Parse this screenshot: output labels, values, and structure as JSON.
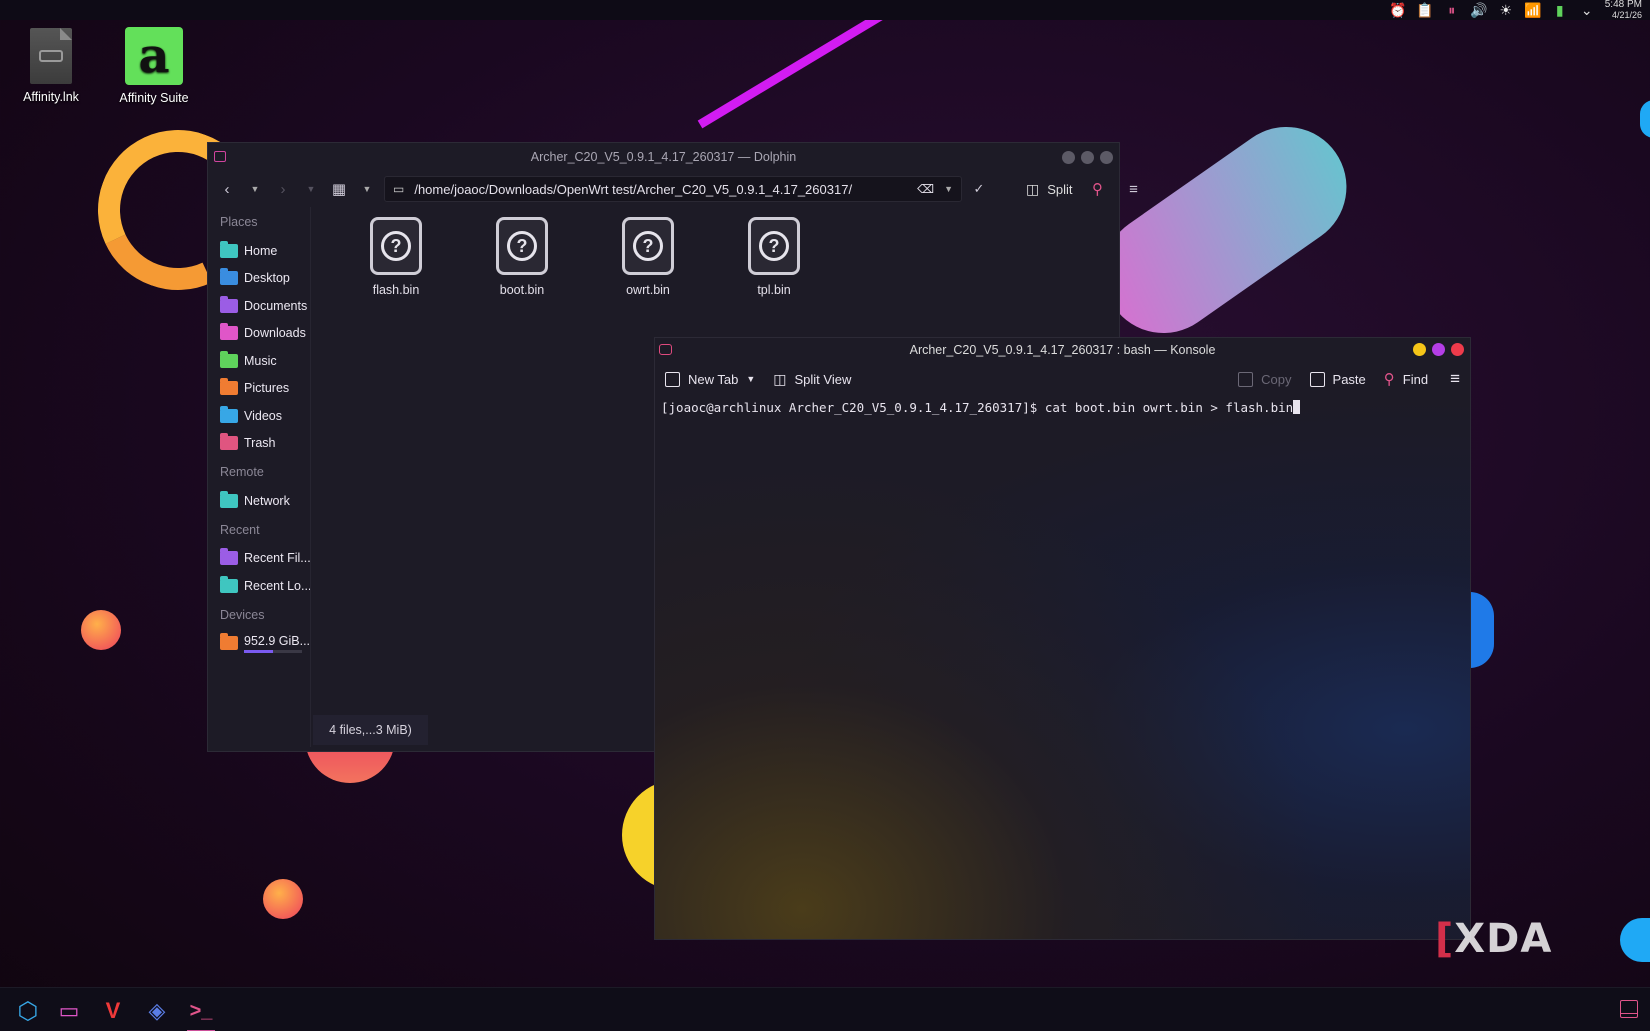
{
  "top_panel": {
    "time": "5:48 PM",
    "date": "4/21/26",
    "tray_icons": [
      "alarm-icon",
      "clipboard-icon",
      "media-pause-icon",
      "volume-icon",
      "brightness-icon",
      "wifi-icon",
      "battery-icon",
      "chevron-down-icon"
    ]
  },
  "desktop": {
    "icons": [
      {
        "label": "Affinity.lnk",
        "icon": "link-file-icon"
      },
      {
        "label": "Affinity Suite",
        "icon": "affinity-icon"
      }
    ],
    "watermark": "XDA"
  },
  "dolphin": {
    "title": "Archer_C20_V5_0.9.1_4.17_260317 — Dolphin",
    "path": "/home/joaoc/Downloads/OpenWrt test/Archer_C20_V5_0.9.1_4.17_260317/",
    "split_label": "Split",
    "sidebar": {
      "places_header": "Places",
      "places": [
        {
          "label": "Home",
          "color": "#3fc6c0"
        },
        {
          "label": "Desktop",
          "color": "#3a8de0"
        },
        {
          "label": "Documents",
          "color": "#9b5de5"
        },
        {
          "label": "Downloads",
          "color": "#e056c8"
        },
        {
          "label": "Music",
          "color": "#5fd35c"
        },
        {
          "label": "Pictures",
          "color": "#f07c32"
        },
        {
          "label": "Videos",
          "color": "#37a7e6"
        },
        {
          "label": "Trash",
          "color": "#e05580"
        }
      ],
      "remote_header": "Remote",
      "remote": [
        {
          "label": "Network",
          "color": "#3fc6c0"
        }
      ],
      "recent_header": "Recent",
      "recent": [
        {
          "label": "Recent Fil...",
          "color": "#9b5de5"
        },
        {
          "label": "Recent Lo...",
          "color": "#3fc6c0"
        }
      ],
      "devices_header": "Devices",
      "devices": [
        {
          "label": "952.9 GiB...",
          "color": "#f07c32",
          "usage_fraction": 0.5
        }
      ]
    },
    "files": [
      {
        "name": "flash.bin"
      },
      {
        "name": "boot.bin"
      },
      {
        "name": "owrt.bin"
      },
      {
        "name": "tpl.bin"
      }
    ],
    "status": "4 files,...3 MiB)"
  },
  "konsole": {
    "title": "Archer_C20_V5_0.9.1_4.17_260317 : bash — Konsole",
    "toolbar": {
      "new_tab": "New Tab",
      "split_view": "Split View",
      "copy": "Copy",
      "paste": "Paste",
      "find": "Find"
    },
    "prompt": "[joaoc@archlinux Archer_C20_V5_0.9.1_4.17_260317]$ ",
    "command": "cat boot.bin owrt.bin > flash.bin",
    "button_colors": [
      "#f5c518",
      "#b43ee6",
      "#ee3b4b"
    ]
  },
  "taskbar": {
    "apps": [
      {
        "name": "app-launcher-icon",
        "color": "#37a7e6"
      },
      {
        "name": "dolphin-icon",
        "color": "#e056c8"
      },
      {
        "name": "vivaldi-icon",
        "color": "#ef3939"
      },
      {
        "name": "discover-icon",
        "color": "#5a7de6"
      },
      {
        "name": "konsole-icon",
        "color": "#e0548a"
      }
    ]
  }
}
